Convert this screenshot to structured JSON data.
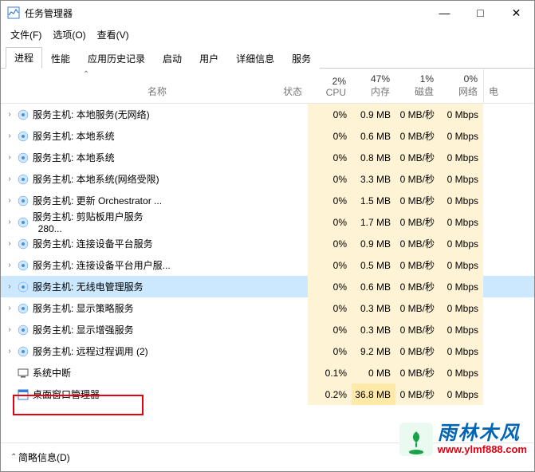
{
  "window": {
    "title": "任务管理器",
    "min": "—",
    "max": "□",
    "close": "✕"
  },
  "menu": {
    "file": "文件(F)",
    "options": "选项(O)",
    "view": "查看(V)"
  },
  "tabs": {
    "processes": "进程",
    "performance": "性能",
    "apphistory": "应用历史记录",
    "startup": "启动",
    "users": "用户",
    "details": "详细信息",
    "services": "服务"
  },
  "columns": {
    "name": "名称",
    "status": "状态",
    "cpu_pct": "2%",
    "cpu": "CPU",
    "mem_pct": "47%",
    "mem": "内存",
    "disk_pct": "1%",
    "disk": "磁盘",
    "net_pct": "0%",
    "net": "网络",
    "extra": "电"
  },
  "rows": [
    {
      "chev": "›",
      "name": "服务主机: 本地服务(无网络)",
      "cpu": "0%",
      "mem": "0.9 MB",
      "disk": "0 MB/秒",
      "net": "0 Mbps",
      "icon": "gear"
    },
    {
      "chev": "›",
      "name": "服务主机: 本地系统",
      "cpu": "0%",
      "mem": "0.6 MB",
      "disk": "0 MB/秒",
      "net": "0 Mbps",
      "icon": "gear"
    },
    {
      "chev": "›",
      "name": "服务主机: 本地系统",
      "cpu": "0%",
      "mem": "0.8 MB",
      "disk": "0 MB/秒",
      "net": "0 Mbps",
      "icon": "gear"
    },
    {
      "chev": "›",
      "name": "服务主机: 本地系统(网络受限)",
      "cpu": "0%",
      "mem": "3.3 MB",
      "disk": "0 MB/秒",
      "net": "0 Mbps",
      "icon": "gear"
    },
    {
      "chev": "›",
      "name": "服务主机: 更新 Orchestrator ...",
      "cpu": "0%",
      "mem": "1.5 MB",
      "disk": "0 MB/秒",
      "net": "0 Mbps",
      "icon": "gear"
    },
    {
      "chev": "›",
      "name": "服务主机: 剪贴板用户服务_280...",
      "cpu": "0%",
      "mem": "1.7 MB",
      "disk": "0 MB/秒",
      "net": "0 Mbps",
      "icon": "gear"
    },
    {
      "chev": "›",
      "name": "服务主机: 连接设备平台服务",
      "cpu": "0%",
      "mem": "0.9 MB",
      "disk": "0 MB/秒",
      "net": "0 Mbps",
      "icon": "gear"
    },
    {
      "chev": "›",
      "name": "服务主机: 连接设备平台用户服...",
      "cpu": "0%",
      "mem": "0.5 MB",
      "disk": "0 MB/秒",
      "net": "0 Mbps",
      "icon": "gear"
    },
    {
      "chev": "›",
      "name": "服务主机: 无线电管理服务",
      "cpu": "0%",
      "mem": "0.6 MB",
      "disk": "0 MB/秒",
      "net": "0 Mbps",
      "icon": "gear",
      "selected": true
    },
    {
      "chev": "›",
      "name": "服务主机: 显示策略服务",
      "cpu": "0%",
      "mem": "0.3 MB",
      "disk": "0 MB/秒",
      "net": "0 Mbps",
      "icon": "gear"
    },
    {
      "chev": "›",
      "name": "服务主机: 显示增强服务",
      "cpu": "0%",
      "mem": "0.3 MB",
      "disk": "0 MB/秒",
      "net": "0 Mbps",
      "icon": "gear"
    },
    {
      "chev": "›",
      "name": "服务主机: 远程过程调用 (2)",
      "cpu": "0%",
      "mem": "9.2 MB",
      "disk": "0 MB/秒",
      "net": "0 Mbps",
      "icon": "gear"
    },
    {
      "chev": "",
      "name": "系统中断",
      "cpu": "0.1%",
      "mem": "0 MB",
      "disk": "0 MB/秒",
      "net": "0 Mbps",
      "icon": "sys"
    },
    {
      "chev": "",
      "name": "桌面窗口管理器",
      "cpu": "0.2%",
      "mem": "36.8 MB",
      "disk": "0 MB/秒",
      "net": "0 Mbps",
      "icon": "dwm",
      "memwarm": true
    }
  ],
  "footer": {
    "brief": "简略信息(D)"
  },
  "watermark": {
    "name": "雨林木风",
    "url": "www.ylmf888.com"
  }
}
